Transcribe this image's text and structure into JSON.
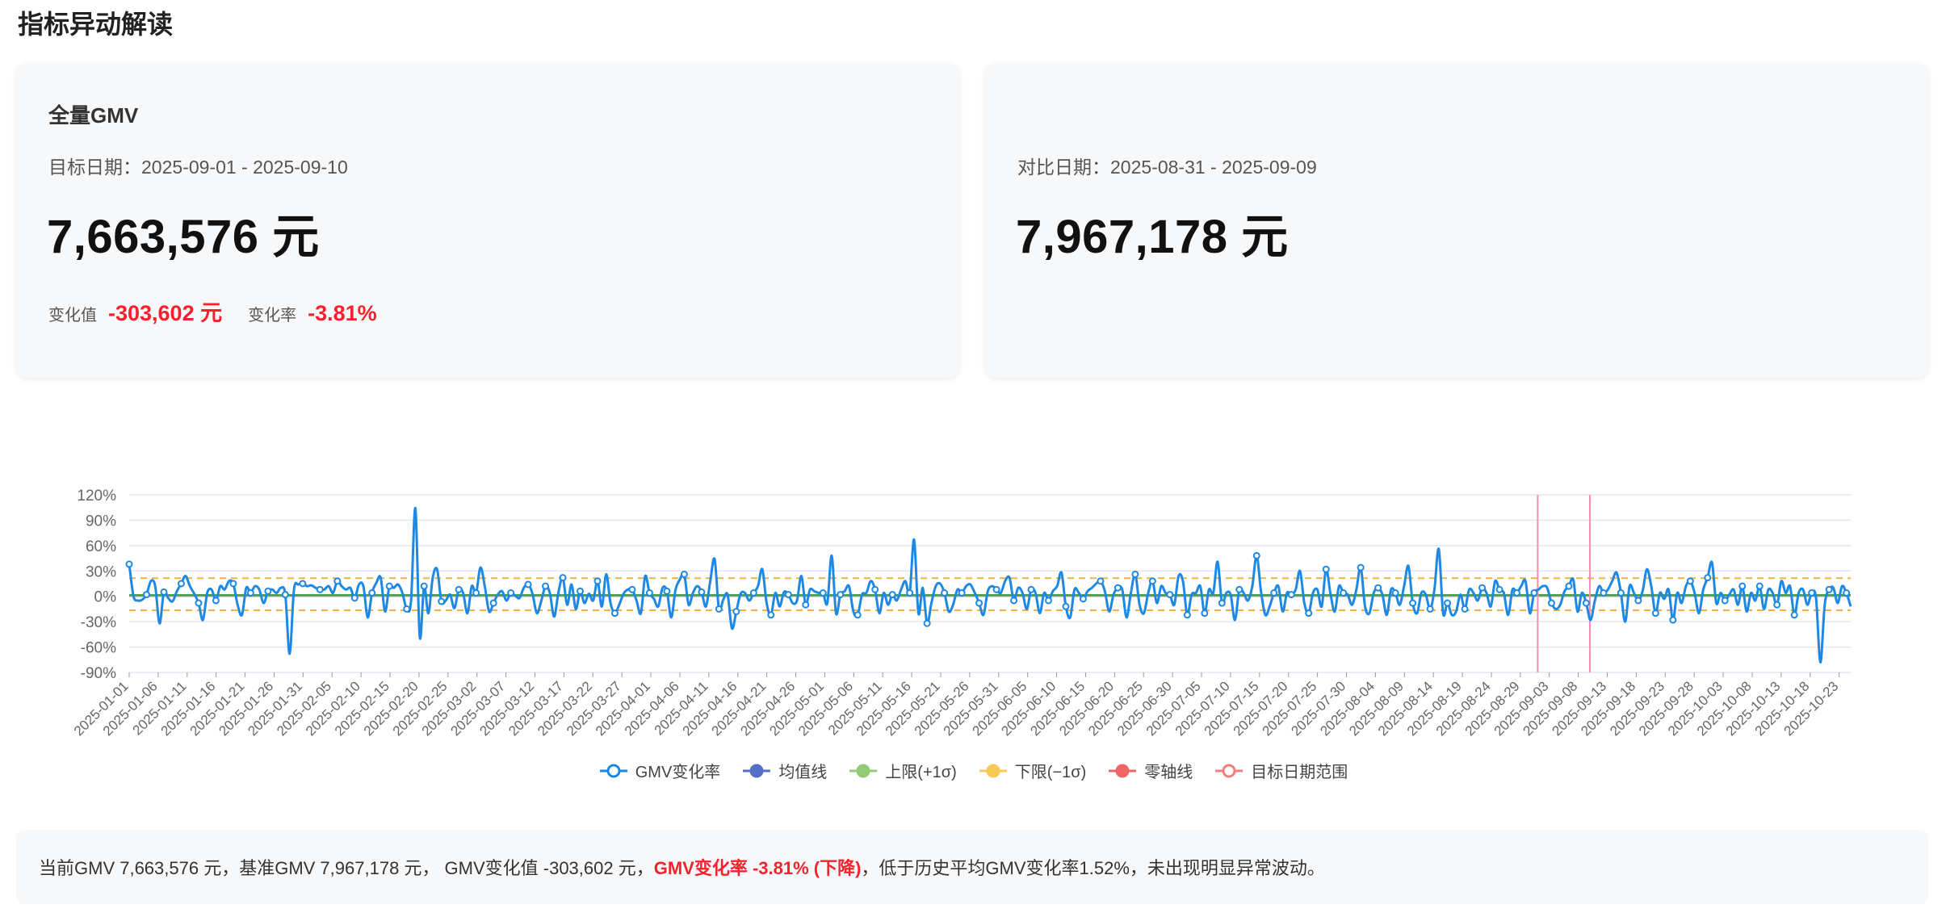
{
  "page_title": "指标异动解读",
  "target_card": {
    "metric_name": "全量GMV",
    "date_label": "目标日期：",
    "date_range": "2025-09-01 - 2025-09-10",
    "value": "7,663,576 元",
    "change_value_label": "变化值",
    "change_value": "-303,602 元",
    "change_rate_label": "变化率",
    "change_rate": "-3.81%"
  },
  "compare_card": {
    "date_label": "对比日期：",
    "date_range": "2025-08-31 - 2025-09-09",
    "value": "7,967,178 元"
  },
  "summary": {
    "prefix": "当前GMV 7,663,576 元，基准GMV 7,967,178 元， GMV变化值 -303,602 元，",
    "highlight": "GMV变化率 -3.81% (下降)",
    "suffix": "，低于历史平均GMV变化率1.52%，未出现明显异常波动。"
  },
  "colors": {
    "series": "#1e88e5",
    "mean": "#3a9a3a",
    "upper": "#f5b041",
    "lower": "#f5b041",
    "zero": "#e57373",
    "target_range": "#f48fb1",
    "negative": "#f5222d"
  },
  "chart_data": {
    "type": "line",
    "start_date": "2025-01-01",
    "end_date": "2025-10-25",
    "tick_every_days": 5,
    "ylim": [
      -90,
      120
    ],
    "yticks": [
      -90,
      -60,
      -30,
      0,
      30,
      60,
      90,
      120
    ],
    "y_format": "percent",
    "mean": 1.52,
    "upper": 21.5,
    "lower": -16.5,
    "target_range": [
      "2025-09-01",
      "2025-09-10"
    ],
    "legend": [
      {
        "name": "GMV变化率",
        "color": "#1e88e5",
        "style": "hollow"
      },
      {
        "name": "均值线",
        "color": "#5470c6",
        "style": "solid"
      },
      {
        "name": "上限(+1σ)",
        "color": "#91cc75",
        "style": "solid"
      },
      {
        "name": "下限(−1σ)",
        "color": "#fac858",
        "style": "solid"
      },
      {
        "name": "零轴线",
        "color": "#ee6666",
        "style": "solid"
      },
      {
        "name": "目标日期范围",
        "color": "#f08080",
        "style": "hollow"
      }
    ],
    "series": [
      {
        "name": "GMV变化率",
        "values": [
          38,
          0,
          -5,
          -4,
          2,
          18,
          12,
          -32,
          5,
          -2,
          -6,
          6,
          15,
          24,
          12,
          3,
          -8,
          -28,
          4,
          8,
          -5,
          12,
          8,
          18,
          15,
          -10,
          -22,
          10,
          4,
          12,
          8,
          -8,
          6,
          8,
          4,
          10,
          2,
          -68,
          8,
          14,
          15,
          12,
          13,
          10,
          8,
          8,
          12,
          4,
          18,
          12,
          8,
          10,
          -2,
          14,
          12,
          -25,
          4,
          16,
          22,
          -18,
          12,
          10,
          14,
          4,
          -15,
          -5,
          104,
          -48,
          12,
          -20,
          22,
          32,
          -6,
          -5,
          2,
          -14,
          8,
          4,
          -20,
          12,
          4,
          34,
          12,
          -18,
          -8,
          2,
          6,
          -5,
          4,
          1,
          -2,
          10,
          14,
          3,
          -20,
          -6,
          12,
          4,
          -24,
          5,
          22,
          -10,
          14,
          -15,
          6,
          -8,
          3,
          -5,
          18,
          -12,
          26,
          -8,
          -20,
          -10,
          3,
          8,
          8,
          -5,
          -20,
          24,
          4,
          -3,
          -12,
          10,
          6,
          -25,
          8,
          20,
          26,
          -10,
          4,
          12,
          5,
          -12,
          18,
          44,
          -15,
          -4,
          2,
          -38,
          -18,
          3,
          4,
          -5,
          4,
          12,
          32,
          -8,
          -22,
          4,
          -12,
          5,
          2,
          -8,
          -5,
          24,
          -10,
          8,
          6,
          4,
          4,
          -8,
          48,
          -20,
          2,
          6,
          12,
          -18,
          -22,
          2,
          4,
          18,
          8,
          -20,
          4,
          -10,
          2,
          -5,
          8,
          18,
          4,
          67,
          -20,
          10,
          -32,
          -8,
          12,
          15,
          4,
          -18,
          -10,
          8,
          4,
          12,
          14,
          4,
          -8,
          -22,
          6,
          12,
          8,
          4,
          18,
          22,
          -5,
          10,
          4,
          -15,
          8,
          4,
          -20,
          4,
          -5,
          6,
          12,
          28,
          -12,
          -25,
          8,
          4,
          -3,
          6,
          10,
          15,
          18,
          6,
          -18,
          2,
          10,
          8,
          -25,
          4,
          26,
          -10,
          -20,
          4,
          18,
          -8,
          12,
          4,
          2,
          -10,
          24,
          18,
          -22,
          2,
          4,
          12,
          -20,
          8,
          4,
          41,
          -8,
          4,
          2,
          -28,
          8,
          4,
          -5,
          12,
          48,
          6,
          -22,
          -12,
          4,
          12,
          -18,
          4,
          2,
          8,
          30,
          -8,
          -20,
          4,
          8,
          -12,
          32,
          4,
          -18,
          12,
          4,
          2,
          -10,
          8,
          34,
          -12,
          -20,
          4,
          10,
          2,
          -22,
          8,
          4,
          -10,
          12,
          36,
          -8,
          -20,
          4,
          2,
          -15,
          8,
          56,
          -20,
          -8,
          -22,
          -18,
          2,
          -15,
          8,
          4,
          -5,
          10,
          4,
          -12,
          18,
          8,
          4,
          -22,
          8,
          4,
          12,
          18,
          -20,
          4,
          8,
          12,
          10,
          -8,
          -15,
          -10,
          6,
          12,
          20,
          -18,
          4,
          -8,
          -28,
          -5,
          12,
          4,
          8,
          18,
          28,
          4,
          -30,
          12,
          4,
          -5,
          6,
          32,
          12,
          -20,
          4,
          -3,
          8,
          -28,
          4,
          -8,
          12,
          18,
          4,
          -20,
          8,
          22,
          40,
          -8,
          4,
          -5,
          2,
          8,
          -10,
          12,
          -18,
          4,
          -5,
          12,
          -15,
          8,
          4,
          -10,
          18,
          4,
          12,
          -22,
          4,
          8,
          -10,
          4,
          -2,
          -78,
          -10,
          8,
          10,
          -8,
          12,
          4,
          -12
        ]
      }
    ]
  }
}
